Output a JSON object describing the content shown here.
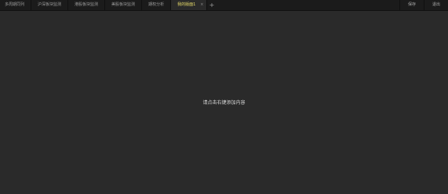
{
  "tabs": [
    {
      "label": "多周期同列"
    },
    {
      "label": "沪深板块监测"
    },
    {
      "label": "港股板块监测"
    },
    {
      "label": "美股板块监测"
    },
    {
      "label": "期权分析"
    }
  ],
  "active_tab": {
    "label": "我的版面1",
    "close_icon": "×"
  },
  "add_tab_icon": "+",
  "actions": {
    "save": "保存",
    "more": "退出"
  },
  "main": {
    "placeholder": "请点击右键添加内容"
  },
  "colors": {
    "background": "#2a2a2a",
    "tabbar": "#1b1b1b",
    "active_tab_text": "#e8dc6a"
  }
}
